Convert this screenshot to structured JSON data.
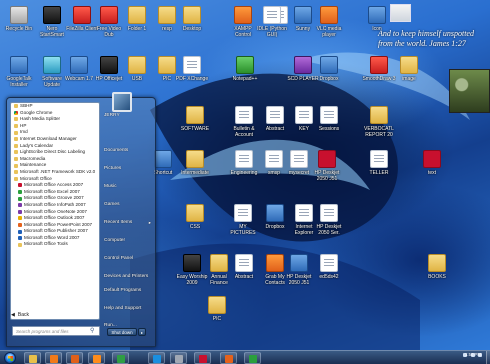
{
  "desktop": {
    "quote_text": "And to keep himself unspotted from the world. James 1:27",
    "icons": [
      {
        "label": "Recycle Bin",
        "glyph": "g-gray",
        "icon": "recycle-bin-icon"
      },
      {
        "label": "Nero StartSmart Essentials",
        "glyph": "g-dark",
        "icon": "nero-icon"
      },
      {
        "label": "FileZilla Client",
        "glyph": "g-red",
        "icon": "filezilla-icon"
      },
      {
        "label": "Free Video Dub",
        "glyph": "g-red",
        "icon": "video-dub-icon"
      },
      {
        "label": "Folder 1",
        "glyph": "g-folder",
        "icon": "folder-icon"
      },
      {
        "label": "resp",
        "glyph": "g-folder",
        "icon": "folder-icon"
      },
      {
        "label": "Desktop",
        "glyph": "g-folder",
        "icon": "folder-icon"
      },
      {
        "label": "",
        "glyph": "g-doc",
        "icon": "document-icon"
      },
      {
        "label": "XAMPP Control",
        "glyph": "g-orange",
        "icon": "xampp-icon"
      },
      {
        "label": "IDLE (Python GUI)",
        "glyph": "g-doc",
        "icon": "document-icon"
      },
      {
        "label": "Sunny",
        "glyph": "g-app",
        "icon": "network-icon"
      },
      {
        "label": "VLC media player",
        "glyph": "g-orange",
        "icon": "vlc-icon"
      },
      {
        "label": "Icon",
        "glyph": "g-app",
        "icon": "shortcut-icon"
      },
      {
        "label": "GoogleTalk Installer",
        "glyph": "g-app",
        "icon": "installer-icon"
      },
      {
        "label": "Software Update",
        "glyph": "g-cyan",
        "icon": "software-update-icon"
      },
      {
        "label": "Webcam 1.7",
        "glyph": "g-app",
        "icon": "webcam-icon"
      },
      {
        "label": "HP Officejet",
        "glyph": "g-dark",
        "icon": "hp-icon"
      },
      {
        "label": "USB",
        "glyph": "g-folder",
        "icon": "folder-icon"
      },
      {
        "label": "PIC",
        "glyph": "g-folder",
        "icon": "folder-icon"
      },
      {
        "label": "PDF XChange",
        "glyph": "g-doc",
        "icon": "document-icon"
      },
      {
        "label": "Notepad++",
        "glyph": "g-green",
        "icon": "notepad-icon"
      },
      {
        "label": "SCD PLAYER",
        "glyph": "g-purple",
        "icon": "player-icon"
      },
      {
        "label": "Dropbox",
        "glyph": "g-app",
        "icon": "dropbox-icon"
      },
      {
        "label": "SmoothDraw 3",
        "glyph": "g-red",
        "icon": "smoothdraw-icon"
      },
      {
        "label": "image",
        "glyph": "g-folder",
        "icon": "folder-icon"
      },
      {
        "label": "SOFTWARE",
        "glyph": "g-folder",
        "icon": "folder-icon"
      },
      {
        "label": "Bulletin & Account",
        "glyph": "g-doc",
        "icon": "document-icon"
      },
      {
        "label": "Abstract",
        "glyph": "g-doc",
        "icon": "document-icon"
      },
      {
        "label": "KEY",
        "glyph": "g-doc",
        "icon": "document-icon"
      },
      {
        "label": "Sessions",
        "glyph": "g-doc",
        "icon": "document-icon"
      },
      {
        "label": "VERBOCATL REPORT 20",
        "glyph": "g-folder",
        "icon": "folder-icon"
      },
      {
        "label": "Shortcut",
        "glyph": "g-app",
        "icon": "shortcut-icon"
      },
      {
        "label": "Intermediate",
        "glyph": "g-folder",
        "icon": "folder-icon"
      },
      {
        "label": "Engineering",
        "glyph": "g-doc",
        "icon": "document-icon"
      },
      {
        "label": "smsp",
        "glyph": "g-doc",
        "icon": "document-icon"
      },
      {
        "label": "mysecret",
        "glyph": "g-doc",
        "icon": "document-icon"
      },
      {
        "label": "HP Deskjet 2050 J51",
        "glyph": "g-pdf",
        "icon": "pdf-icon"
      },
      {
        "label": "TELLER",
        "glyph": "g-doc",
        "icon": "document-icon"
      },
      {
        "label": "text",
        "glyph": "g-pdf",
        "icon": "pdf-icon"
      },
      {
        "label": "CSS",
        "glyph": "g-folder",
        "icon": "folder-icon"
      },
      {
        "label": "MY PICTURES",
        "glyph": "g-doc",
        "icon": "document-icon"
      },
      {
        "label": "Dropbox",
        "glyph": "g-app",
        "icon": "dropbox-icon"
      },
      {
        "label": "Internet Explorer",
        "glyph": "g-doc",
        "icon": "document-icon"
      },
      {
        "label": "HP Deskjet 2050 Ser.",
        "glyph": "g-doc",
        "icon": "document-icon"
      },
      {
        "label": "Easy Worship 2009",
        "glyph": "g-dark",
        "icon": "easyworship-icon"
      },
      {
        "label": "Annual Finance",
        "glyph": "g-folder",
        "icon": "folder-icon"
      },
      {
        "label": "Abstract",
        "glyph": "g-doc",
        "icon": "document-icon"
      },
      {
        "label": "Grab My Contacts",
        "glyph": "g-orange",
        "icon": "contacts-icon"
      },
      {
        "label": "HP Deskjet 2050 J51",
        "glyph": "g-app",
        "icon": "printer-icon"
      },
      {
        "label": "ed5ds42",
        "glyph": "g-doc",
        "icon": "document-icon"
      },
      {
        "label": "PIC",
        "glyph": "g-folder",
        "icon": "folder-icon"
      },
      {
        "label": "BOOKS",
        "glyph": "g-folder",
        "icon": "folder-icon"
      }
    ]
  },
  "start_menu": {
    "programs": [
      {
        "label": "SBHP",
        "icon": "pi-folder",
        "sub": false
      },
      {
        "label": "Google Chrome",
        "icon": "pi-chrome",
        "sub": false
      },
      {
        "label": "Hash Media Splitter",
        "icon": "pi-folder",
        "sub": false
      },
      {
        "label": "HP",
        "icon": "pi-folder",
        "sub": false
      },
      {
        "label": "Imd",
        "icon": "pi-folder",
        "sub": false
      },
      {
        "label": "Internet Download Manager",
        "icon": "pi-folder",
        "sub": false
      },
      {
        "label": "Lady's Calendar",
        "icon": "pi-folder",
        "sub": false
      },
      {
        "label": "LightScribe Direct Disc Labeling",
        "icon": "pi-folder",
        "sub": false
      },
      {
        "label": "Macromedia",
        "icon": "pi-folder",
        "sub": false
      },
      {
        "label": "Maintenance",
        "icon": "pi-folder",
        "sub": false
      },
      {
        "label": "Microsoft .NET Framework SDK v2.0",
        "icon": "pi-folder",
        "sub": false
      },
      {
        "label": "Microsoft Office",
        "icon": "pi-folder",
        "sub": false
      },
      {
        "label": "Microsoft Office Access 2007",
        "icon": "pi-red",
        "sub": true
      },
      {
        "label": "Microsoft Office Excel 2007",
        "icon": "pi-green",
        "sub": true
      },
      {
        "label": "Microsoft Office Groove 2007",
        "icon": "pi-green",
        "sub": true
      },
      {
        "label": "Microsoft Office InfoPath 2007",
        "icon": "pi-purple",
        "sub": true
      },
      {
        "label": "Microsoft Office OneNote 2007",
        "icon": "pi-purple",
        "sub": true
      },
      {
        "label": "Microsoft Office Outlook 2007",
        "icon": "pi-yellow",
        "sub": true
      },
      {
        "label": "Microsoft Office PowerPoint 2007",
        "icon": "pi-orange",
        "sub": true
      },
      {
        "label": "Microsoft Office Publisher 2007",
        "icon": "pi-blue",
        "sub": true
      },
      {
        "label": "Microsoft Office Word 2007",
        "icon": "pi-blue",
        "sub": true
      },
      {
        "label": "Microsoft Office Tools",
        "icon": "pi-folder",
        "sub": true
      }
    ],
    "back_label": "Back",
    "search_placeholder": "Search programs and files",
    "right_items": [
      {
        "label": "JERRY",
        "caret": ""
      },
      {
        "label": "Documents",
        "caret": ""
      },
      {
        "label": "Pictures",
        "caret": ""
      },
      {
        "label": "Music",
        "caret": ""
      },
      {
        "label": "Games",
        "caret": ""
      },
      {
        "label": "Recent Items",
        "caret": "▸"
      },
      {
        "label": "Computer",
        "caret": ""
      },
      {
        "label": "Control Panel",
        "caret": ""
      },
      {
        "label": "Devices and Printers",
        "caret": ""
      },
      {
        "label": "Default Programs",
        "caret": ""
      },
      {
        "label": "Help and Support",
        "caret": ""
      },
      {
        "label": "Run...",
        "caret": ""
      }
    ],
    "shutdown_label": "Shut down",
    "shutdown_arrow": "▸"
  },
  "taskbar": {
    "buttons": [
      {
        "icon": "explorer-icon",
        "color": "#e8c04a"
      },
      {
        "icon": "media-player-icon",
        "color": "#f07a1a"
      },
      {
        "icon": "firefox-icon",
        "color": "#e0601a"
      },
      {
        "icon": "vlc-icon",
        "color": "#ff8c1a"
      },
      {
        "icon": "chrome-icon",
        "color": "#2f9e44"
      },
      {
        "icon": "skype-icon",
        "color": "#1a8fe0"
      },
      {
        "icon": "calculator-icon",
        "color": "#a0a8b4"
      },
      {
        "icon": "acrobat-icon",
        "color": "#c8102e"
      },
      {
        "icon": "powerpoint-icon",
        "color": "#e5621c"
      },
      {
        "icon": "excel-icon",
        "color": "#2a9f3c"
      }
    ],
    "clock_time": "1:50 PM",
    "clock_date": "",
    "colors": {
      "taskbar": "#1c3760",
      "accent": "#2f7ad8"
    }
  }
}
